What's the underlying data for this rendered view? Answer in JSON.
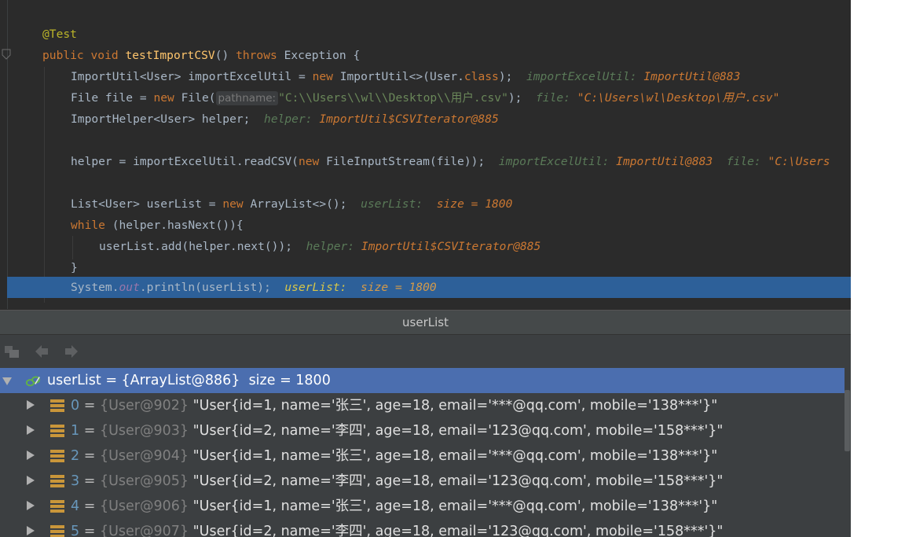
{
  "editor": {
    "lines": [
      {
        "annotation": "@Test"
      },
      {
        "kw_public": "public",
        "kw_void": "void",
        "method": "testImportCSV",
        "paren": "()",
        "kw_throws": "throws",
        "exception": "Exception {"
      },
      {
        "type": "ImportUtil<User>",
        "var": "importExcelUtil",
        "eq": "=",
        "kw_new": "new",
        "ctor": "ImportUtil<>(User.",
        "kw_class": "class",
        "end": ");",
        "inline_name": "importExcelUtil:",
        "inline_val": "ImportUtil@883"
      },
      {
        "type": "File file =",
        "kw_new": "new",
        "ctor": "File(",
        "param_hint": "pathname:",
        "string": "\"C:\\\\Users\\\\wl\\\\Desktop\\\\用户.csv\"",
        "end": ");",
        "inline_name": "file:",
        "inline_val": "\"C:\\Users\\wl\\Desktop\\用户.csv\""
      },
      {
        "text": "ImportHelper<User> helper;",
        "inline_name": "helper:",
        "inline_val": "ImportUtil$CSVIterator@885"
      },
      {
        "text": "helper = importExcelUtil.readCSV(",
        "kw_new": "new",
        "rest": "FileInputStream(file));",
        "inline_name": "importExcelUtil:",
        "inline_val": "ImportUtil@883",
        "inline_name2": "file:",
        "inline_val2": "\"C:\\Users"
      },
      {
        "text": "List<User> userList =",
        "kw_new": "new",
        "rest": "ArrayList<>();",
        "inline_name": "userList:",
        "inline_val": "size = 1800"
      },
      {
        "kw_while": "while",
        "rest": "(helper.hasNext()){"
      },
      {
        "text": "userList.add(helper.next());",
        "inline_name": "helper:",
        "inline_val": "ImportUtil$CSVIterator@885"
      },
      {
        "text": "}"
      },
      {
        "text1": "System.",
        "field": "out",
        "text2": ".println(userList);",
        "inline_name": "userList:",
        "inline_val": "size = 1800"
      }
    ]
  },
  "debug": {
    "title": "userList",
    "root": {
      "label": "userList = {ArrayList@886}  size = 1800"
    },
    "items": [
      {
        "index": "0",
        "ref": "{User@902}",
        "value": "\"User{id=1, name='张三', age=18, email='***@qq.com', mobile='138***'}\""
      },
      {
        "index": "1",
        "ref": "{User@903}",
        "value": "\"User{id=2, name='李四', age=18, email='123@qq.com', mobile='158***'}\""
      },
      {
        "index": "2",
        "ref": "{User@904}",
        "value": "\"User{id=1, name='张三', age=18, email='***@qq.com', mobile='138***'}\""
      },
      {
        "index": "3",
        "ref": "{User@905}",
        "value": "\"User{id=2, name='李四', age=18, email='123@qq.com', mobile='158***'}\""
      },
      {
        "index": "4",
        "ref": "{User@906}",
        "value": "\"User{id=1, name='张三', age=18, email='***@qq.com', mobile='138***'}\""
      },
      {
        "index": "5",
        "ref": "{User@907}",
        "value": "\"User{id=2, name='李四', age=18, email='123@qq.com', mobile='158***'}\""
      }
    ],
    "eq": "="
  }
}
